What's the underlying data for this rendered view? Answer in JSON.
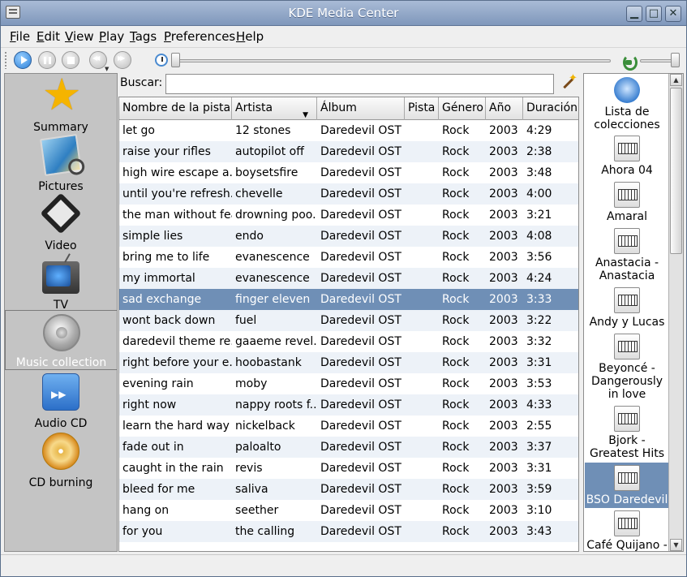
{
  "window": {
    "title": "KDE Media Center"
  },
  "menu": [
    {
      "label": "File",
      "key": "F",
      "rest": "ile"
    },
    {
      "label": "Edit",
      "key": "E",
      "rest": "dit"
    },
    {
      "label": "View",
      "key": "V",
      "rest": "iew"
    },
    {
      "label": "Play",
      "key": "P",
      "rest": "lay"
    },
    {
      "label": "Tags",
      "key": "T",
      "rest": "ags"
    },
    {
      "label": "Preferences",
      "key": "P",
      "rest": "references"
    },
    {
      "label": "Help",
      "key": "H",
      "rest": "elp"
    }
  ],
  "sidebar": {
    "items": [
      {
        "label": "Summary",
        "icon": "star-icon"
      },
      {
        "label": "Pictures",
        "icon": "pictures-icon"
      },
      {
        "label": "Video",
        "icon": "video-icon"
      },
      {
        "label": "TV",
        "icon": "tv-icon"
      },
      {
        "label": "Music collection",
        "icon": "speaker-icon",
        "selected": true
      },
      {
        "label": "Audio CD",
        "icon": "audio-cd-icon"
      },
      {
        "label": "CD burning",
        "icon": "cd-burning-icon"
      }
    ]
  },
  "search": {
    "label": "Buscar:",
    "value": ""
  },
  "table": {
    "columns": [
      "Nombre de la pista",
      "Artista",
      "Álbum",
      "Pista",
      "Género",
      "Año",
      "Duración"
    ],
    "rows": [
      [
        "let go",
        "12 stones",
        "Daredevil OST",
        "",
        "Rock",
        "2003",
        "4:29"
      ],
      [
        "raise your rifles",
        "autopilot off",
        "Daredevil OST",
        "",
        "Rock",
        "2003",
        "2:38"
      ],
      [
        "high wire escape a...",
        "boysetsfire",
        "Daredevil OST",
        "",
        "Rock",
        "2003",
        "3:48"
      ],
      [
        "until you're refresh...",
        "chevelle",
        "Daredevil OST",
        "",
        "Rock",
        "2003",
        "4:00"
      ],
      [
        "the man without fear",
        "drowning poo...",
        "Daredevil OST",
        "",
        "Rock",
        "2003",
        "3:21"
      ],
      [
        "simple lies",
        "endo",
        "Daredevil OST",
        "",
        "Rock",
        "2003",
        "4:08"
      ],
      [
        "bring me to life",
        "evanescence",
        "Daredevil OST",
        "",
        "Rock",
        "2003",
        "3:56"
      ],
      [
        "my immortal",
        "evanescence",
        "Daredevil OST",
        "",
        "Rock",
        "2003",
        "4:24"
      ],
      [
        "sad exchange",
        "finger eleven",
        "Daredevil OST",
        "",
        "Rock",
        "2003",
        "3:33"
      ],
      [
        "wont back down",
        "fuel",
        "Daredevil OST",
        "",
        "Rock",
        "2003",
        "3:22"
      ],
      [
        "daredevil theme re...",
        "gaaeme revel...",
        "Daredevil OST",
        "",
        "Rock",
        "2003",
        "3:32"
      ],
      [
        "right before your e...",
        "hoobastank",
        "Daredevil OST",
        "",
        "Rock",
        "2003",
        "3:31"
      ],
      [
        "evening rain",
        "moby",
        "Daredevil OST",
        "",
        "Rock",
        "2003",
        "3:53"
      ],
      [
        "right now",
        "nappy roots f...",
        "Daredevil OST",
        "",
        "Rock",
        "2003",
        "4:33"
      ],
      [
        "learn the hard way",
        "nickelback",
        "Daredevil OST",
        "",
        "Rock",
        "2003",
        "2:55"
      ],
      [
        "fade out in",
        "paloalto",
        "Daredevil OST",
        "",
        "Rock",
        "2003",
        "3:37"
      ],
      [
        "caught in the rain",
        "revis",
        "Daredevil OST",
        "",
        "Rock",
        "2003",
        "3:31"
      ],
      [
        "bleed for me",
        "saliva",
        "Daredevil OST",
        "",
        "Rock",
        "2003",
        "3:59"
      ],
      [
        "hang on",
        "seether",
        "Daredevil OST",
        "",
        "Rock",
        "2003",
        "3:10"
      ],
      [
        "for you",
        "the calling",
        "Daredevil OST",
        "",
        "Rock",
        "2003",
        "3:43"
      ]
    ],
    "selected_row": 8
  },
  "collections": {
    "items": [
      {
        "label": "Lista de colecciones",
        "icon": "collections-icon"
      },
      {
        "label": "Ahora 04",
        "icon": "piano-icon"
      },
      {
        "label": "Amaral",
        "icon": "piano-icon"
      },
      {
        "label": "Anastacia - Anastacia",
        "icon": "piano-icon"
      },
      {
        "label": "Andy y Lucas",
        "icon": "piano-icon"
      },
      {
        "label": "Beyoncé - Dangerously in love",
        "icon": "piano-icon"
      },
      {
        "label": "Bjork - Greatest Hits",
        "icon": "piano-icon"
      },
      {
        "label": "BSO Daredevil",
        "icon": "piano-icon",
        "selected": true
      },
      {
        "label": "Café Quijano -",
        "icon": "piano-icon"
      }
    ]
  }
}
